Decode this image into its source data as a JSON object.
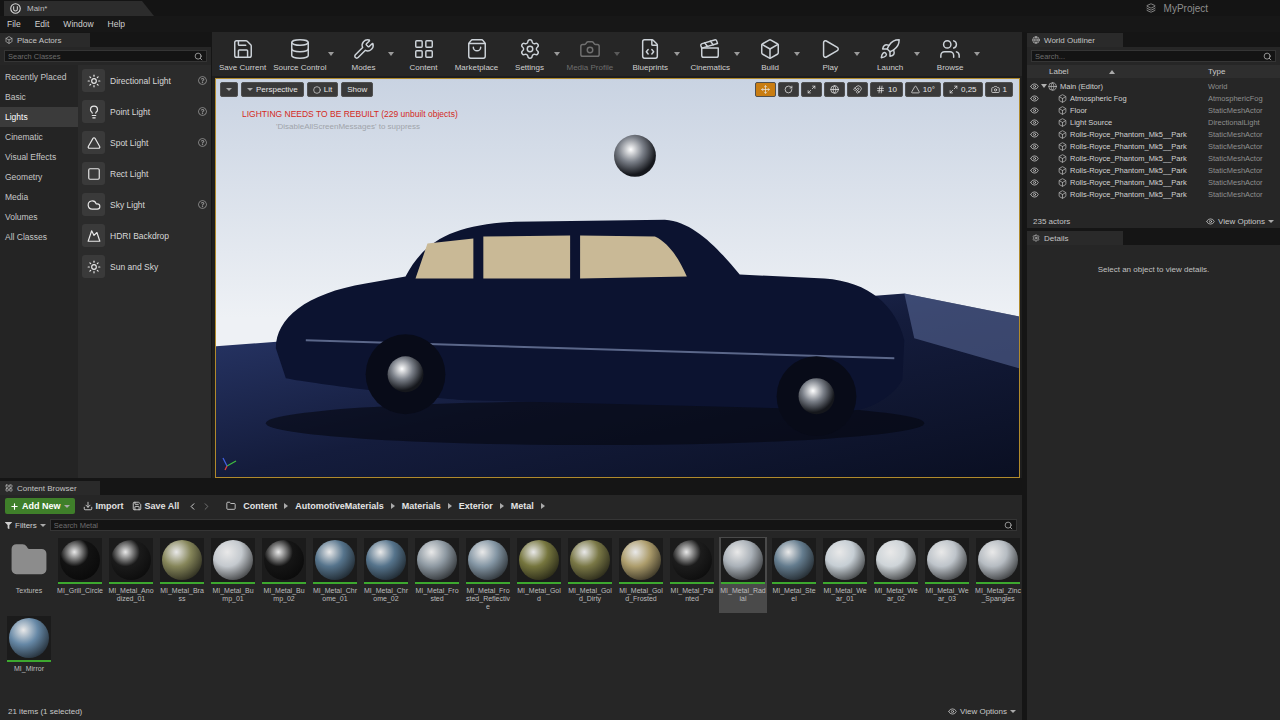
{
  "window": {
    "tab": "Main*",
    "project": "MyProject"
  },
  "menu": [
    {
      "label": "File"
    },
    {
      "label": "Edit"
    },
    {
      "label": "Window"
    },
    {
      "label": "Help"
    }
  ],
  "place_actors": {
    "title": "Place Actors",
    "search": {
      "placeholder": "Search Classes"
    },
    "categories": [
      {
        "label": "Recently Placed",
        "selected": false
      },
      {
        "label": "Basic",
        "selected": false
      },
      {
        "label": "Lights",
        "selected": true
      },
      {
        "label": "Cinematic",
        "selected": false
      },
      {
        "label": "Visual Effects",
        "selected": false
      },
      {
        "label": "Geometry",
        "selected": false
      },
      {
        "label": "Media",
        "selected": false
      },
      {
        "label": "Volumes",
        "selected": false
      },
      {
        "label": "All Classes",
        "selected": false
      }
    ],
    "items": [
      {
        "label": "Directional Light",
        "help": true
      },
      {
        "label": "Point Light",
        "help": true
      },
      {
        "label": "Spot Light",
        "help": true
      },
      {
        "label": "Rect Light",
        "help": false
      },
      {
        "label": "Sky Light",
        "help": true
      },
      {
        "label": "HDRI Backdrop",
        "help": false
      },
      {
        "label": "Sun and Sky",
        "help": false
      }
    ]
  },
  "toolbar": {
    "buttons": [
      {
        "label": "Save Current",
        "dropdown": false,
        "disabled": false
      },
      {
        "label": "Source Control",
        "dropdown": true,
        "disabled": false
      },
      {
        "label": "Modes",
        "dropdown": true,
        "disabled": false
      },
      {
        "label": "Content",
        "dropdown": false,
        "disabled": false
      },
      {
        "label": "Marketplace",
        "dropdown": false,
        "disabled": false
      },
      {
        "label": "Settings",
        "dropdown": true,
        "disabled": false
      },
      {
        "label": "Media Profile",
        "dropdown": true,
        "disabled": true
      },
      {
        "label": "Blueprints",
        "dropdown": true,
        "disabled": false
      },
      {
        "label": "Cinematics",
        "dropdown": true,
        "disabled": false
      },
      {
        "label": "Build",
        "dropdown": true,
        "disabled": false
      },
      {
        "label": "Play",
        "dropdown": true,
        "disabled": false
      },
      {
        "label": "Launch",
        "dropdown": true,
        "disabled": false
      },
      {
        "label": "Browse",
        "dropdown": true,
        "disabled": false
      }
    ]
  },
  "viewport": {
    "perspective": "Perspective",
    "view_mode": "Lit",
    "show": "Show",
    "warning": "LIGHTING NEEDS TO BE REBUILT (229 unbuilt objects)",
    "hint": "'DisableAllScreenMessages' to suppress",
    "tools": [
      {
        "selected": true
      },
      {
        "selected": false
      },
      {
        "selected": false
      }
    ],
    "snaps": [
      {
        "value": "10"
      },
      {
        "value": "10°"
      },
      {
        "value": "0,25"
      },
      {
        "value": "1"
      }
    ]
  },
  "outliner": {
    "title": "World Outliner",
    "search": {
      "placeholder": "Search..."
    },
    "columns": [
      "Label",
      "Type"
    ],
    "rows": [
      {
        "label": "Main (Editor)",
        "type": "World",
        "depth": 0,
        "expanded": true,
        "visible": true
      },
      {
        "label": "Atmospheric Fog",
        "type": "AtmosphericFog",
        "depth": 1,
        "expanded": false,
        "visible": true
      },
      {
        "label": "Floor",
        "type": "StaticMeshActor",
        "depth": 1,
        "expanded": false,
        "visible": true
      },
      {
        "label": "Light Source",
        "type": "DirectionalLight",
        "depth": 1,
        "expanded": false,
        "visible": true
      },
      {
        "label": "Rolls-Royce_Phantom_Mk5__Park",
        "type": "StaticMeshActor",
        "depth": 1,
        "expanded": false,
        "visible": true
      },
      {
        "label": "Rolls-Royce_Phantom_Mk5__Park",
        "type": "StaticMeshActor",
        "depth": 1,
        "expanded": false,
        "visible": true
      },
      {
        "label": "Rolls-Royce_Phantom_Mk5__Park",
        "type": "StaticMeshActor",
        "depth": 1,
        "expanded": false,
        "visible": true
      },
      {
        "label": "Rolls-Royce_Phantom_Mk5__Park",
        "type": "StaticMeshActor",
        "depth": 1,
        "expanded": false,
        "visible": true
      },
      {
        "label": "Rolls-Royce_Phantom_Mk5__Park",
        "type": "StaticMeshActor",
        "depth": 1,
        "expanded": false,
        "visible": true
      },
      {
        "label": "Rolls-Royce_Phantom_Mk5__Park",
        "type": "StaticMeshActor",
        "depth": 1,
        "expanded": false,
        "visible": true
      }
    ],
    "count": "235 actors",
    "view_options": "View Options"
  },
  "details": {
    "title": "Details",
    "empty": "Select an object to view details."
  },
  "content_browser": {
    "title": "Content Browser",
    "add_new": "Add New",
    "import": "Import",
    "save_all": "Save All",
    "path": [
      "Content",
      "AutomotiveMaterials",
      "Materials",
      "Exterior",
      "Metal"
    ],
    "filters": "Filters",
    "search": {
      "placeholder": "Search Metal"
    },
    "assets": [
      {
        "name": "Textures",
        "kind": "folder",
        "selected": false,
        "color": "#8c8c8c"
      },
      {
        "name": "MI_Grill_Circle",
        "kind": "material",
        "selected": false,
        "color": "#121212"
      },
      {
        "name": "MI_Metal_Anodized_01",
        "kind": "material",
        "selected": false,
        "color": "#1a1a1a"
      },
      {
        "name": "MI_Metal_Brass",
        "kind": "material",
        "selected": false,
        "color": "#86865a"
      },
      {
        "name": "MI_Metal_Bump_01",
        "kind": "material",
        "selected": false,
        "color": "#c4c9ce"
      },
      {
        "name": "MI_Metal_Bump_02",
        "kind": "material",
        "selected": false,
        "color": "#151515"
      },
      {
        "name": "MI_Metal_Chrome_01",
        "kind": "material",
        "selected": false,
        "color": "#56748c"
      },
      {
        "name": "MI_Metal_Chrome_02",
        "kind": "material",
        "selected": false,
        "color": "#56748c"
      },
      {
        "name": "MI_Metal_Frosted",
        "kind": "material",
        "selected": false,
        "color": "#8f9aa3"
      },
      {
        "name": "MI_Metal_Frosted_Reflective",
        "kind": "material",
        "selected": false,
        "color": "#8496a4"
      },
      {
        "name": "MI_Metal_Gold",
        "kind": "material",
        "selected": false,
        "color": "#76763e"
      },
      {
        "name": "MI_Metal_Gold_Dirty",
        "kind": "material",
        "selected": false,
        "color": "#7a7846"
      },
      {
        "name": "MI_Metal_Gold_Frosted",
        "kind": "material",
        "selected": false,
        "color": "#ad9d6c"
      },
      {
        "name": "MI_Metal_Painted",
        "kind": "material",
        "selected": false,
        "color": "#1c1c1c"
      },
      {
        "name": "MI_Metal_Radial",
        "kind": "material",
        "selected": true,
        "color": "#aab1b8"
      },
      {
        "name": "MI_Metal_Steel",
        "kind": "material",
        "selected": false,
        "color": "#647c8e"
      },
      {
        "name": "MI_Metal_Wear_01",
        "kind": "material",
        "selected": false,
        "color": "#c6ced4"
      },
      {
        "name": "MI_Metal_Wear_02",
        "kind": "material",
        "selected": false,
        "color": "#ced4d8"
      },
      {
        "name": "MI_Metal_Wear_03",
        "kind": "material",
        "selected": false,
        "color": "#bec4ca"
      },
      {
        "name": "MI_Metal_Zinc_Spangles",
        "kind": "material",
        "selected": false,
        "color": "#b6bcc2"
      },
      {
        "name": "MI_Mirror",
        "kind": "material",
        "selected": false,
        "color": "#6688a6"
      }
    ],
    "status": "21 items (1 selected)",
    "view_options": "View Options"
  }
}
